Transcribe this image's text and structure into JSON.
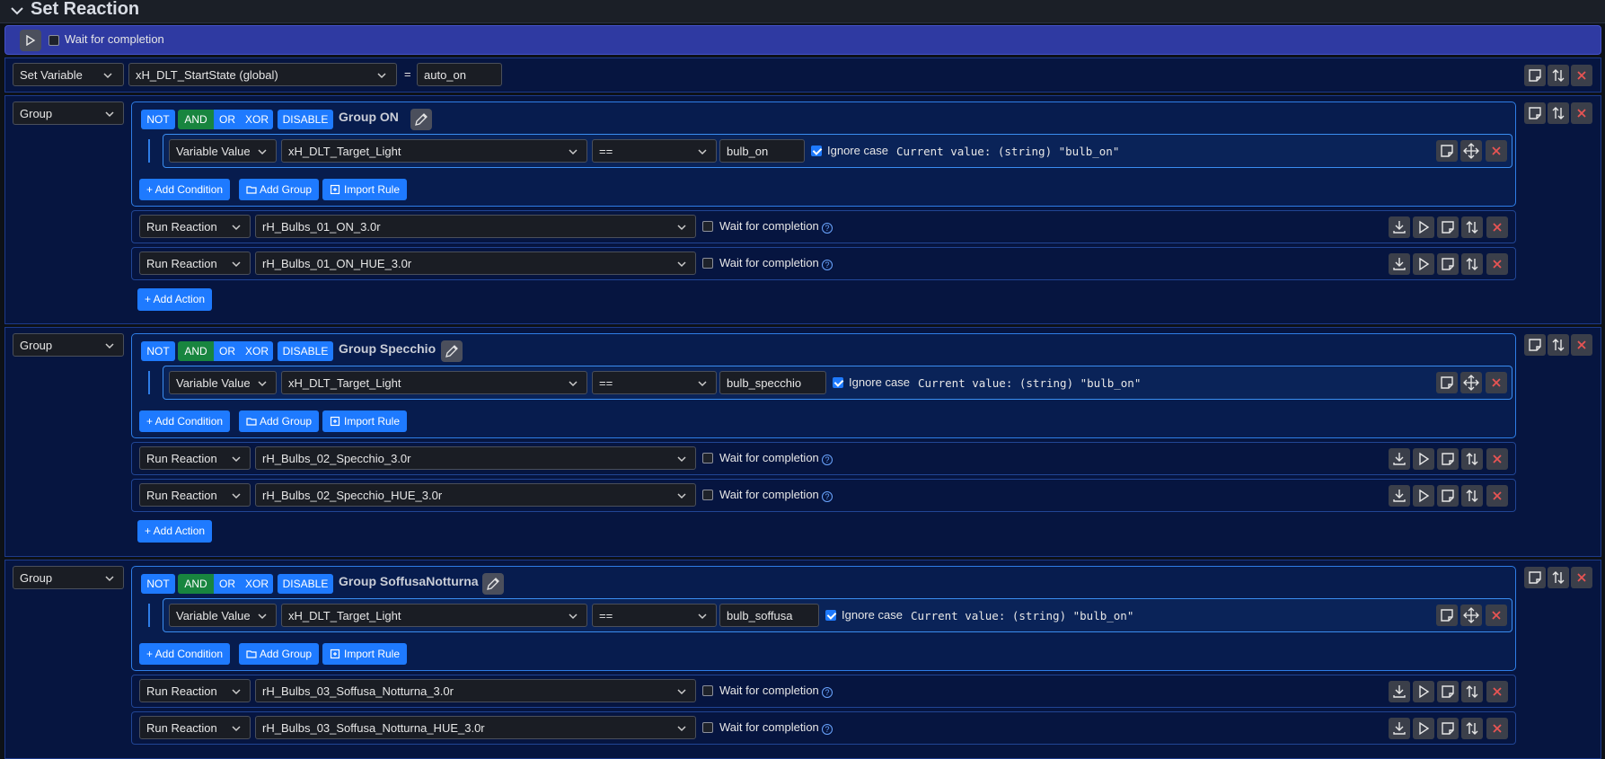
{
  "header": {
    "title": "Set Reaction"
  },
  "runbar": {
    "wait_label": "Wait for completion"
  },
  "set_variable": {
    "type": "Set Variable",
    "variable": "xH_DLT_StartState (global)",
    "equals": "=",
    "value": "auto_on"
  },
  "groups": [
    {
      "type": "Group",
      "not": "NOT",
      "and": "AND",
      "or": "OR",
      "xor": "XOR",
      "disable": "DISABLE",
      "title": "Group ON",
      "cond_type": "Variable Value",
      "cond_var": "xH_DLT_Target_Light",
      "cond_op": "==",
      "cond_value": "bulb_on",
      "ignore_case": "Ignore case",
      "current": "Current value: (string) \"bulb_on\"",
      "add_condition": "+ Add Condition",
      "add_group": "Add Group",
      "import_rule": "Import Rule",
      "actions": [
        {
          "type": "Run Reaction",
          "reaction": "rH_Bulbs_01_ON_3.0r",
          "wait": "Wait for completion"
        },
        {
          "type": "Run Reaction",
          "reaction": "rH_Bulbs_01_ON_HUE_3.0r",
          "wait": "Wait for completion"
        }
      ],
      "add_action": "+ Add Action"
    },
    {
      "type": "Group",
      "not": "NOT",
      "and": "AND",
      "or": "OR",
      "xor": "XOR",
      "disable": "DISABLE",
      "title": "Group Specchio",
      "cond_type": "Variable Value",
      "cond_var": "xH_DLT_Target_Light",
      "cond_op": "==",
      "cond_value": "bulb_specchio",
      "ignore_case": "Ignore case",
      "current": "Current value: (string) \"bulb_on\"",
      "add_condition": "+ Add Condition",
      "add_group": "Add Group",
      "import_rule": "Import Rule",
      "actions": [
        {
          "type": "Run Reaction",
          "reaction": "rH_Bulbs_02_Specchio_3.0r",
          "wait": "Wait for completion"
        },
        {
          "type": "Run Reaction",
          "reaction": "rH_Bulbs_02_Specchio_HUE_3.0r",
          "wait": "Wait for completion"
        }
      ],
      "add_action": "+ Add Action"
    },
    {
      "type": "Group",
      "not": "NOT",
      "and": "AND",
      "or": "OR",
      "xor": "XOR",
      "disable": "DISABLE",
      "title": "Group SoffusaNotturna",
      "cond_type": "Variable Value",
      "cond_var": "xH_DLT_Target_Light",
      "cond_op": "==",
      "cond_value": "bulb_soffusa",
      "ignore_case": "Ignore case",
      "current": "Current value: (string) \"bulb_on\"",
      "add_condition": "+ Add Condition",
      "add_group": "Add Group",
      "import_rule": "Import Rule",
      "actions": [
        {
          "type": "Run Reaction",
          "reaction": "rH_Bulbs_03_Soffusa_Notturna_3.0r",
          "wait": "Wait for completion"
        },
        {
          "type": "Run Reaction",
          "reaction": "rH_Bulbs_03_Soffusa_Notturna_HUE_3.0r",
          "wait": "Wait for completion"
        }
      ]
    }
  ]
}
